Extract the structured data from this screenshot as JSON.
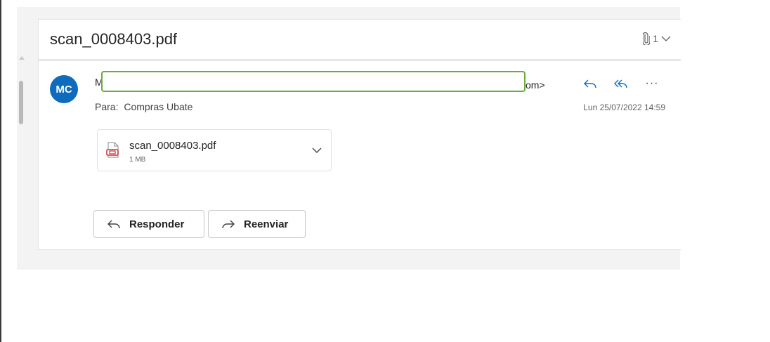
{
  "email": {
    "subject": "scan_0008403.pdf",
    "attachment_count": "1",
    "avatar_initials": "MC",
    "sender_initial": "M",
    "sender_tail": "om>",
    "to_label": "Para:",
    "to_value": "Compras Ubate",
    "date": "Lun 25/07/2022 14:59",
    "more_label": "···"
  },
  "attachment": {
    "name": "scan_0008403.pdf",
    "size": "1 MB"
  },
  "buttons": {
    "reply": "Responder",
    "forward": "Reenviar"
  },
  "colors": {
    "accent": "#0f6cbd",
    "redaction_border": "#6aaa3e",
    "pdf_red": "#d13438"
  },
  "icons": [
    "paperclip-icon",
    "chevron-down-icon",
    "reply-icon",
    "reply-all-icon",
    "more-icon",
    "pdf-file-icon",
    "forward-icon"
  ]
}
